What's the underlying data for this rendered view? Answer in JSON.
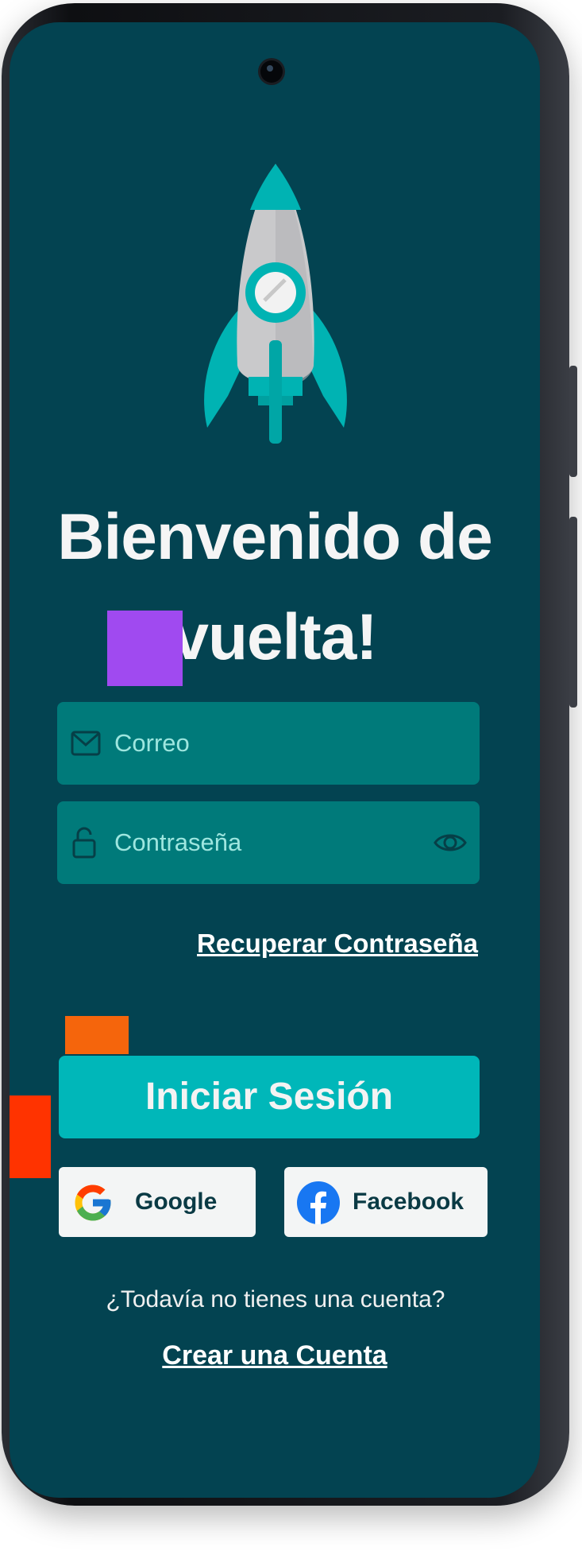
{
  "title": {
    "line1": "Bienvenido de",
    "line2": "vuelta!"
  },
  "form": {
    "email_placeholder": "Correo",
    "password_placeholder": "Contraseña",
    "recover_link": "Recuperar Contraseña"
  },
  "actions": {
    "login_label": "Iniciar Sesión",
    "google_label": "Google",
    "facebook_label": "Facebook"
  },
  "signup": {
    "question": "¿Todavía no tienes una cuenta?",
    "create_link": "Crear una Cuenta"
  },
  "icons": {
    "logo": "rocket-icon",
    "email": "mail-icon",
    "password": "lock-icon",
    "toggle_password": "eye-icon",
    "google": "google-logo-icon",
    "facebook": "facebook-logo-icon"
  },
  "colors": {
    "background": "#034351",
    "field": "#007a7a",
    "primary_button": "#00b7b9",
    "social_button": "#f3f5f5",
    "deco_purple": "#a04af0",
    "deco_orange": "#f5650c",
    "deco_red": "#ff3300"
  }
}
